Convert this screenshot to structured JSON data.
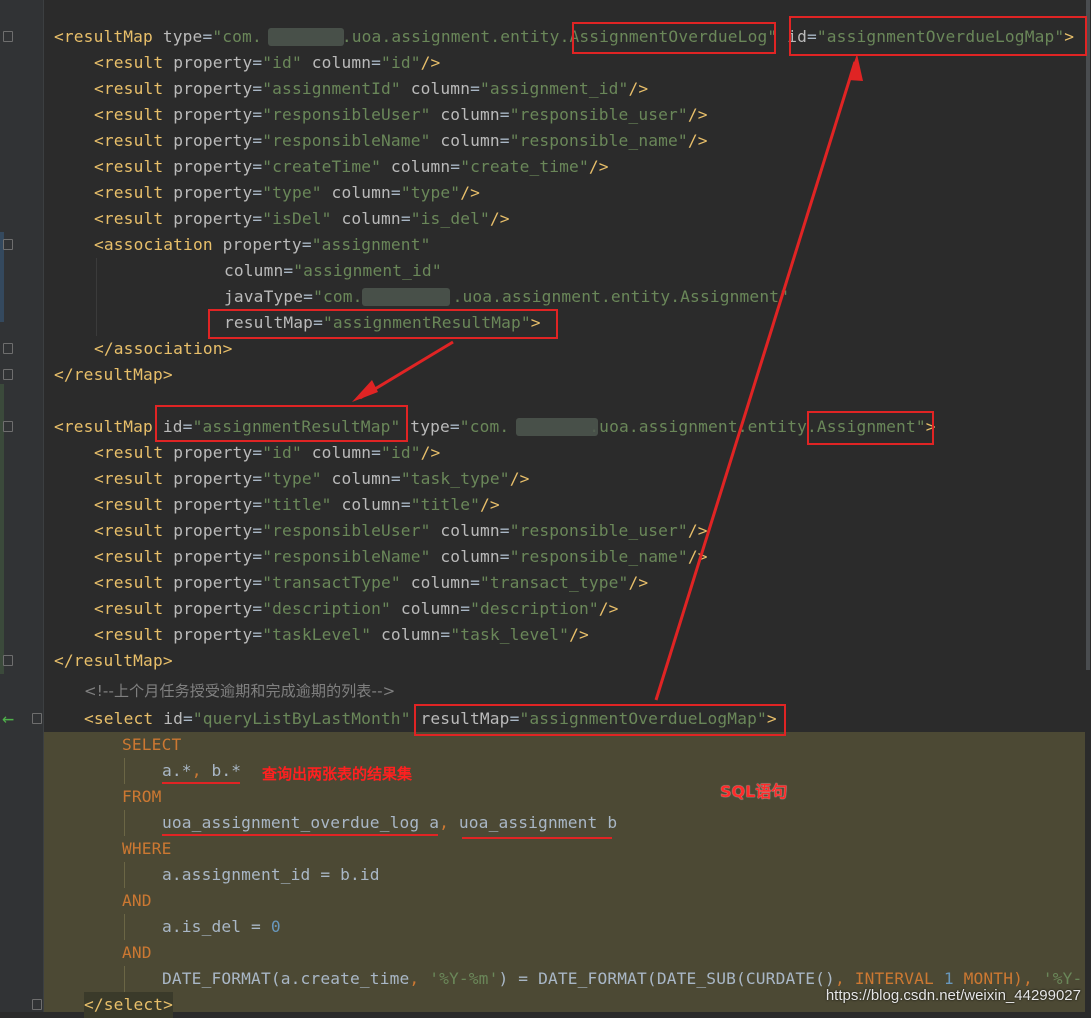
{
  "code_lines": {
    "l1": {
      "tag": "<resultMap",
      "a1": "type",
      "v1": "\"com.",
      "v1b": ".uoa.assignment.entity.AssignmentOverdueLog\"",
      "a2": "id",
      "v2": "\"assignmentOverdueLogMap\"",
      "end": ">"
    },
    "l2": {
      "tag": "<result",
      "a1": "property",
      "v1": "\"id\"",
      "a2": "column",
      "v2": "\"id\"",
      "end": "/>"
    },
    "l3": {
      "tag": "<result",
      "a1": "property",
      "v1": "\"assignmentId\"",
      "a2": "column",
      "v2": "\"assignment_id\"",
      "end": "/>"
    },
    "l4": {
      "tag": "<result",
      "a1": "property",
      "v1": "\"responsibleUser\"",
      "a2": "column",
      "v2": "\"responsible_user\"",
      "end": "/>"
    },
    "l5": {
      "tag": "<result",
      "a1": "property",
      "v1": "\"responsibleName\"",
      "a2": "column",
      "v2": "\"responsible_name\"",
      "end": "/>"
    },
    "l6": {
      "tag": "<result",
      "a1": "property",
      "v1": "\"createTime\"",
      "a2": "column",
      "v2": "\"create_time\"",
      "end": "/>"
    },
    "l7": {
      "tag": "<result",
      "a1": "property",
      "v1": "\"type\"",
      "a2": "column",
      "v2": "\"type\"",
      "end": "/>"
    },
    "l8": {
      "tag": "<result",
      "a1": "property",
      "v1": "\"isDel\"",
      "a2": "column",
      "v2": "\"is_del\"",
      "end": "/>"
    },
    "l9": {
      "tag": "<association",
      "a1": "property",
      "v1": "\"assignment\""
    },
    "l10": {
      "a1": "column",
      "v1": "\"assignment_id\""
    },
    "l11": {
      "a1": "javaType",
      "v1": "\"com.",
      "v1b": ".uoa.assignment.entity.Assignment\""
    },
    "l12": {
      "a1": "resultMap",
      "v1": "\"assignmentResultMap\"",
      "end": ">"
    },
    "l13": {
      "tag": "</association>"
    },
    "l14": {
      "tag": "</resultMap>"
    },
    "l16": {
      "tag": "<resultMap",
      "a1": "id",
      "v1": "\"assignmentResultMap\"",
      "a2": "type",
      "v2": "\"com.",
      "v2b": ".uoa.assignment.entity.Assignment\"",
      "end": ">"
    },
    "l17": {
      "tag": "<result",
      "a1": "property",
      "v1": "\"id\"",
      "a2": "column",
      "v2": "\"id\"",
      "end": "/>"
    },
    "l18": {
      "tag": "<result",
      "a1": "property",
      "v1": "\"type\"",
      "a2": "column",
      "v2": "\"task_type\"",
      "end": "/>"
    },
    "l19": {
      "tag": "<result",
      "a1": "property",
      "v1": "\"title\"",
      "a2": "column",
      "v2": "\"title\"",
      "end": "/>"
    },
    "l20": {
      "tag": "<result",
      "a1": "property",
      "v1": "\"responsibleUser\"",
      "a2": "column",
      "v2": "\"responsible_user\"",
      "end": "/>"
    },
    "l21": {
      "tag": "<result",
      "a1": "property",
      "v1": "\"responsibleName\"",
      "a2": "column",
      "v2": "\"responsible_name\"",
      "end": "/>"
    },
    "l22": {
      "tag": "<result",
      "a1": "property",
      "v1": "\"transactType\"",
      "a2": "column",
      "v2": "\"transact_type\"",
      "end": "/>"
    },
    "l23": {
      "tag": "<result",
      "a1": "property",
      "v1": "\"description\"",
      "a2": "column",
      "v2": "\"description\"",
      "end": "/>"
    },
    "l24": {
      "tag": "<result",
      "a1": "property",
      "v1": "\"taskLevel\"",
      "a2": "column",
      "v2": "\"task_level\"",
      "end": "/>"
    },
    "l25": {
      "tag": "</resultMap>"
    },
    "l26": {
      "comment": "<!--上个月任务授受逾期和完成逾期的列表-->"
    },
    "l27": {
      "tag": "<select",
      "a1": "id",
      "v1": "\"queryListByLastMonth\"",
      "a2": "resultMap",
      "v2": "\"assignmentOverdueLogMap\"",
      "end": ">"
    },
    "l28": {
      "kw": "SELECT"
    },
    "l29": {
      "p1": "a.*",
      "p2": ", ",
      "p3": "b.*"
    },
    "l30": {
      "kw": "FROM"
    },
    "l31": {
      "p1": "uoa_assignment_overdue_log",
      "p2": " a",
      "p3": ", ",
      "p4": "uoa_assignment",
      "p5": " b"
    },
    "l32": {
      "kw": "WHERE"
    },
    "l33": {
      "p1": "a.assignment_id = b.id"
    },
    "l34": {
      "kw": "AND"
    },
    "l35": {
      "p1": "a.is_del = ",
      "num": "0"
    },
    "l36": {
      "kw": "AND"
    },
    "l37": {
      "p1": "DATE_FORMAT(a.create_time",
      "p2": ", ",
      "s1": "'%Y-%m'",
      "p3": ") = DATE_FORMAT(DATE_SUB(CURDATE()",
      "p4": ", ",
      "kw": "INTERVAL ",
      "num": "1",
      "kw2": " MONTH)",
      "p5": ", ",
      "s2": "'%Y-"
    },
    "l38": {
      "tag": "</select>"
    }
  },
  "annotations": {
    "note_result_set": "查询出两张表的结果集",
    "note_sql": "SQL语句"
  },
  "watermark": "https://blog.csdn.net/weixin_44299027",
  "colors": {
    "tag": "#e8bf6a",
    "attr_value": "#6a8759",
    "keyword": "#cc7832",
    "number": "#6897bb",
    "annotation": "#e02424",
    "sql_highlight": "#4c4934"
  },
  "icons": {
    "caret": "green-left-arrow-icon",
    "fold": "fold-marker-icon"
  }
}
